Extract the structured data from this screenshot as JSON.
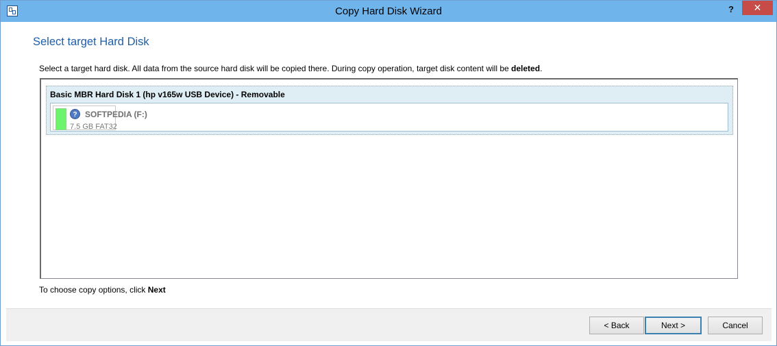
{
  "window": {
    "title": "Copy Hard Disk Wizard",
    "help_label": "?",
    "close_label": "✕"
  },
  "page": {
    "heading": "Select target Hard Disk",
    "instruction_text": "Select a target hard disk. All data from the source hard disk will be copied there. During copy operation, target disk content will be ",
    "instruction_emphasis": "deleted",
    "instruction_end": ".",
    "hint_text": "To choose copy options, click ",
    "hint_emphasis": "Next"
  },
  "disks": [
    {
      "title": "Basic MBR Hard Disk 1 (hp v165w USB Device) - Removable",
      "partitions": [
        {
          "name": "SOFTPEDIA (F:)",
          "info": "7.5 GB FAT32",
          "icon": "question-icon",
          "usage_color": "#6cf46c"
        }
      ]
    }
  ],
  "buttons": {
    "back": "< Back",
    "next": "Next >",
    "cancel": "Cancel"
  },
  "colors": {
    "titlebar": "#6fb5ec",
    "heading": "#1e5ea8",
    "close": "#c74b46",
    "selection_bg": "#dfeef5"
  }
}
